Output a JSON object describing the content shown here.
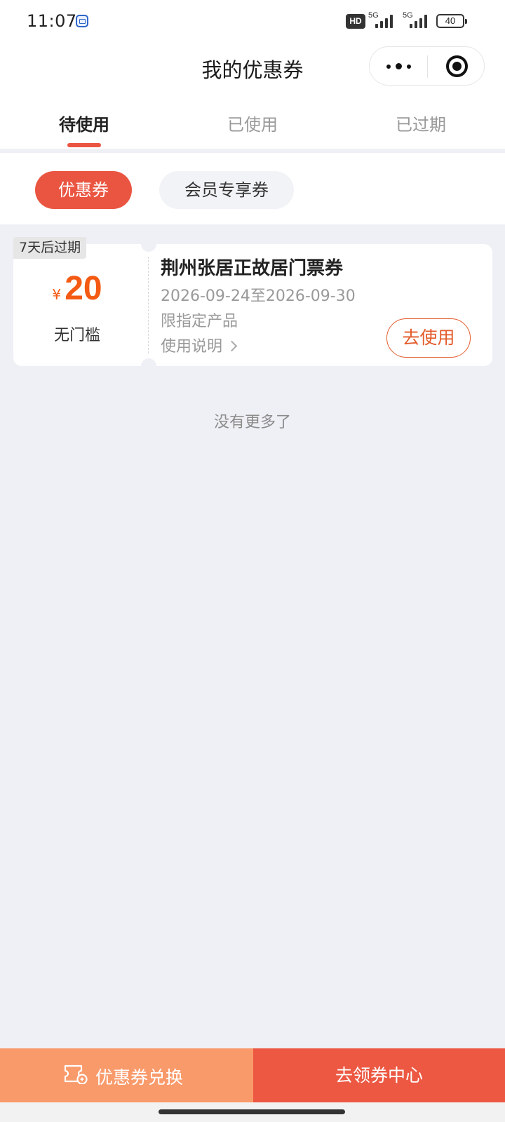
{
  "status_bar": {
    "time": "11:07",
    "hd_label": "HD",
    "network_1": "5G",
    "network_2": "5G",
    "battery": "40"
  },
  "header": {
    "title": "我的优惠券",
    "more_icon": "more-dots-icon",
    "close_icon": "target-close-icon"
  },
  "tabs": [
    {
      "label": "待使用",
      "active": true
    },
    {
      "label": "已使用",
      "active": false
    },
    {
      "label": "已过期",
      "active": false
    }
  ],
  "filters": [
    {
      "label": "优惠券",
      "selected": true
    },
    {
      "label": "会员专享券",
      "selected": false
    }
  ],
  "coupons": [
    {
      "expire_tag": "7天后过期",
      "currency": "¥",
      "amount": "20",
      "threshold": "无门槛",
      "title": "荆州张居正故居门票券",
      "date_range": "2026-09-24至2026-09-30",
      "scope": "限指定产品",
      "instructions": "使用说明",
      "action": "去使用"
    }
  ],
  "no_more_text": "没有更多了",
  "bottom_bar": {
    "redeem_label": "优惠券兑换",
    "center_label": "去领券中心"
  },
  "colors": {
    "accent": "#ea5541",
    "amount": "#f45a13",
    "redeem_bg": "#f99a6b",
    "page_bg": "#eff0f5"
  }
}
